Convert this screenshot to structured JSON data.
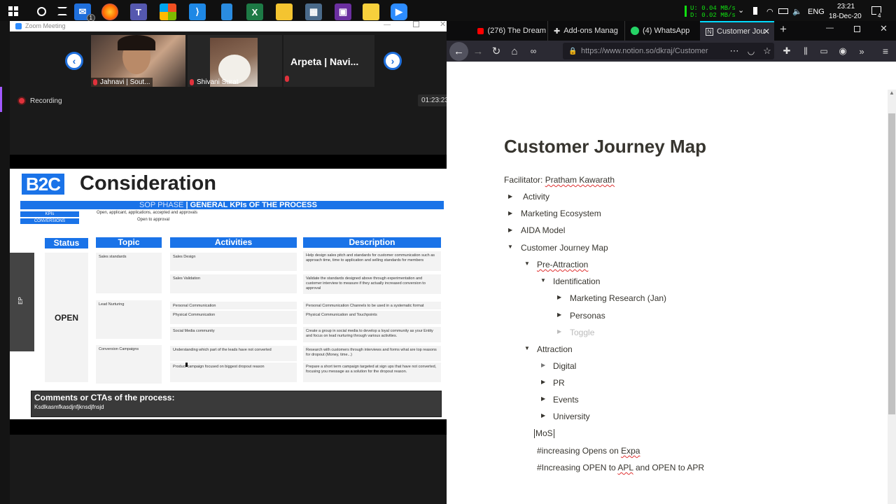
{
  "taskbar": {
    "mail_badge": "1",
    "tray": {
      "upload": "U:   0.04 MB/s",
      "download": "D:   0.02 MB/s",
      "lang": "ENG",
      "time": "23:21",
      "date": "18-Dec-20",
      "notif_badge": "4"
    }
  },
  "zoom": {
    "window_title": "Zoom Meeting",
    "participants": [
      {
        "name": "Jahnavi | Sout..."
      },
      {
        "name": "Shivani Surat"
      },
      {
        "name": "Arpeta |   Navi..."
      }
    ],
    "recording_label": "Recording",
    "timer": "01:23:23",
    "side_tab": "EP"
  },
  "slide": {
    "badge": "B2C",
    "title": "Consideration",
    "phase_light": "SOP PHASE",
    "phase_bold": "| GENERAL KPIs OF THE PROCESS",
    "kpis_label": "KPIs",
    "kpis_value": "Open, applicant, applications, accepted and approvals",
    "conversions_label": "CONVERSIONS",
    "conversions_value": "Open to approval",
    "headers": [
      "Status",
      "Topic",
      "Activities",
      "Description"
    ],
    "status": "OPEN",
    "topics": [
      "Sales standards",
      "Lead Nurturing",
      "Conversion Campaigns"
    ],
    "activities": [
      "Sales Design",
      "Sales Validation",
      "Personal Communication",
      "Physical Communication",
      "Social Media community",
      "Understanding which  part of the leads have not converted",
      "Product campaign focused on biggest dropout reason"
    ],
    "descriptions": [
      "Help design sales pitch and standards for customer communication such as approach time, time to application and selling standards for members",
      "Validate the standards designed above through experimentation and customer interview to measure if they actually increased conversion to approval",
      "Personal Communication Channels to be used in a systematic format",
      "Physical Communication and Touchpoints",
      "Create a group in social media to develop a loyal community as your Entity and focus on lead nurturing through various activities.",
      "Research with customers through interviews and forms what are top reasons for dropout (Money, time...)",
      "Prepare a short term campaign targeted at sign ups that have not converted, focusing you message as a solution for the dropout reason."
    ],
    "comments_title": "Comments or CTAs of the process:",
    "comments_text": "Ksdlkasmfkasdjnfjknsdjfnsjd"
  },
  "firefox": {
    "tabs": [
      {
        "label": "(276) The Dream"
      },
      {
        "label": "Add-ons Manag"
      },
      {
        "label": "(4) WhatsApp"
      },
      {
        "label": "Customer Jou"
      }
    ],
    "url": "https://www.notion.so/dkraj/Customer"
  },
  "notion": {
    "title": "Customer Journey Map",
    "facilitator_label": "Facilitator: ",
    "facilitator_name": "Pratham Kawarath",
    "items": {
      "activity": "Activity",
      "ecosystem": "Marketing Ecosystem",
      "aida": "AIDA Model",
      "cjm": "Customer Journey Map",
      "pre_attraction": "Pre-Attraction",
      "identification": "Identification",
      "research": "Marketing Research  (Jan)",
      "personas": "Personas",
      "toggle": "Toggle",
      "attraction": "Attraction",
      "digital": "Digital",
      "pr": "PR",
      "events": "Events",
      "university": "University"
    },
    "mos": "MoS",
    "line1_prefix": "#increasing Opens on ",
    "line1_link": "Expa",
    "line2_prefix": "#Increasing OPEN to ",
    "line2_apl": "APL",
    "line2_suffix": " and OPEN to APR"
  }
}
